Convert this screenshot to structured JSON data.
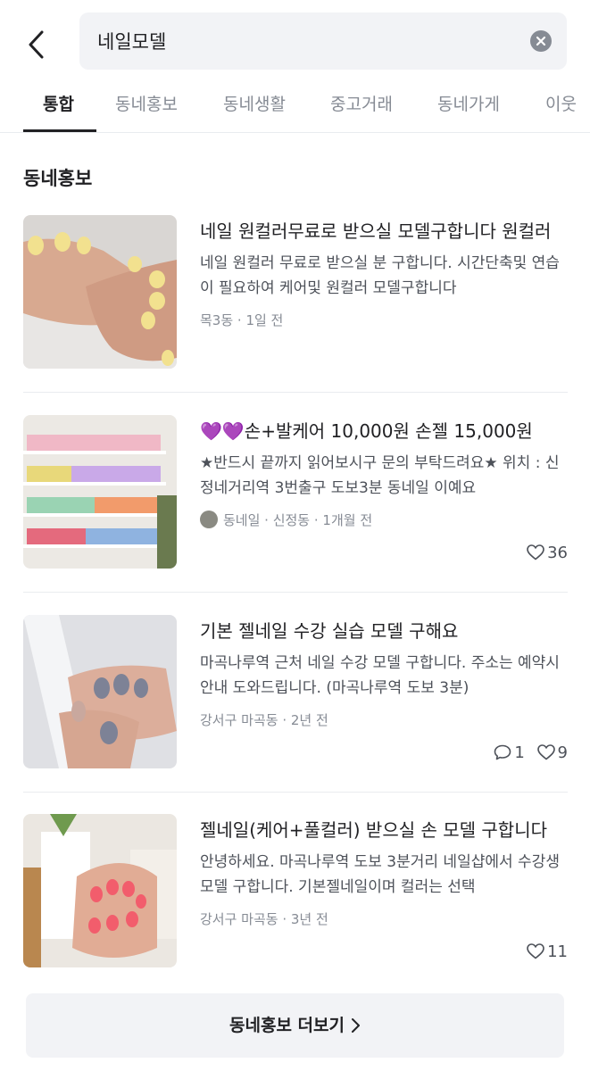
{
  "search": {
    "query": "네일모델"
  },
  "tabs": [
    "통합",
    "동네홍보",
    "동네생활",
    "중고거래",
    "동네가게",
    "이웃"
  ],
  "section": {
    "title": "동네홍보"
  },
  "items": [
    {
      "title": "네일 원컬러무료로 받으실 모델구합니다 원컬러",
      "desc": "네일 원컬러 무료로 받으실 분 구합니다. 시간단축및 연습이 필요하여 케어및 원컬러 모델구합니다",
      "meta": "목3동 · 1일 전",
      "comments": "",
      "likes": ""
    },
    {
      "title": "💜💜손+발케어 10,000원 손젤 15,000원",
      "desc": "★반드시 끝까지 읽어보시구 문의 부탁드려요★ 위치 : 신정네거리역 3번출구 도보3분 동네일 이예요",
      "meta": "동네일 · 신정동 · 1개월 전",
      "comments": "",
      "likes": "36"
    },
    {
      "title": "기본 젤네일 수강 실습 모델 구해요",
      "desc": "마곡나루역 근처 네일 수강 모델 구합니다. 주소는 예약시 안내 도와드립니다. (마곡나루역 도보 3분)",
      "meta": "강서구 마곡동 · 2년 전",
      "comments": "1",
      "likes": "9"
    },
    {
      "title": "젤네일(케어+풀컬러) 받으실 손 모델 구합니다",
      "desc": "안녕하세요. 마곡나루역 도보 3분거리 네일샵에서 수강생 모델 구합니다. 기본젤네일이며 컬러는 선택",
      "meta": "강서구 마곡동 · 3년 전",
      "comments": "",
      "likes": "11"
    }
  ],
  "more_button": {
    "label": "동네홍보 더보기"
  }
}
